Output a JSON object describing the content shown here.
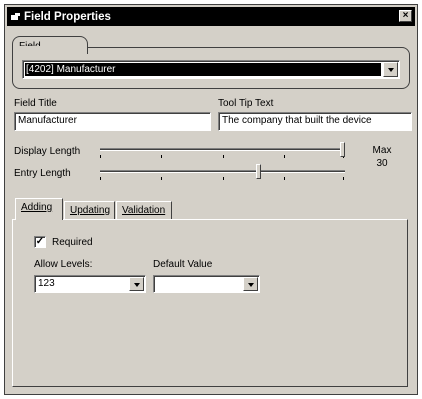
{
  "window": {
    "title": "Field Properties",
    "close_glyph": "×"
  },
  "field": {
    "group_label": "Field",
    "selected_value": "[4202] Manufacturer"
  },
  "field_title": {
    "label": "Field Title",
    "value": "Manufacturer"
  },
  "tooltip_text": {
    "label": "Tool Tip Text",
    "value": "The company that built the device"
  },
  "display_length": {
    "label": "Display Length",
    "level": 1.0
  },
  "entry_length": {
    "label": "Entry Length",
    "level": 0.65
  },
  "max": {
    "label": "Max",
    "value": "30"
  },
  "tabs": [
    {
      "label": "Adding",
      "hotkey": "A",
      "active": true
    },
    {
      "label": "Updating",
      "hotkey": "U",
      "active": false
    },
    {
      "label": "Validation",
      "hotkey": "V",
      "active": false
    }
  ],
  "adding": {
    "required_label": "Required",
    "required_checked": true,
    "check_glyph": "✓",
    "allow_levels": {
      "label": "Allow Levels:",
      "value": "123"
    },
    "default_value": {
      "label": "Default Value",
      "value": ""
    }
  }
}
